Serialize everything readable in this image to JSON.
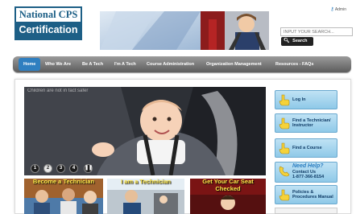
{
  "logo": {
    "line1": "National CPS",
    "line2": "Certification"
  },
  "admin": {
    "label": "Admin"
  },
  "search": {
    "placeholder": "INPUT YOUR SEARCH...",
    "button": "Search"
  },
  "nav": {
    "items": [
      {
        "label": "Home",
        "active": true
      },
      {
        "label": "Who We Are"
      },
      {
        "label": "Be A Tech"
      },
      {
        "label": "I'm A Tech"
      },
      {
        "label": "Course Administration"
      },
      {
        "label": "Organization Management"
      },
      {
        "label": "Resources - FAQs"
      }
    ]
  },
  "slider": {
    "caption": "Children are not in fact safer",
    "buttons": [
      "1",
      "2",
      "3",
      "4"
    ],
    "active": "2",
    "pause_icon": "pause-icon"
  },
  "promos": [
    {
      "title": "Become a Technician"
    },
    {
      "title": "I am a Technician"
    },
    {
      "title": "Get Your Car Seat Checked"
    }
  ],
  "sidebar": {
    "items": [
      {
        "label": "Log In",
        "icon": "hand-pointer-icon"
      },
      {
        "label": "Find a Technician/ Instructor",
        "icon": "hand-pointer-icon"
      },
      {
        "label": "Find a Course",
        "icon": "hand-pointer-icon"
      },
      {
        "title": "Need Help?",
        "label": "Contact Us",
        "phone": "1-877-366-8154",
        "icon": "phone-icon"
      },
      {
        "label": "Policies & Procedures Manual",
        "icon": "hand-pointer-icon"
      }
    ]
  },
  "colors": {
    "brand": "#1d5f86",
    "nav_active": "#2f7fc0",
    "promo_title": "#ffe94a",
    "sidebar_bg": "#9fd2ee"
  }
}
